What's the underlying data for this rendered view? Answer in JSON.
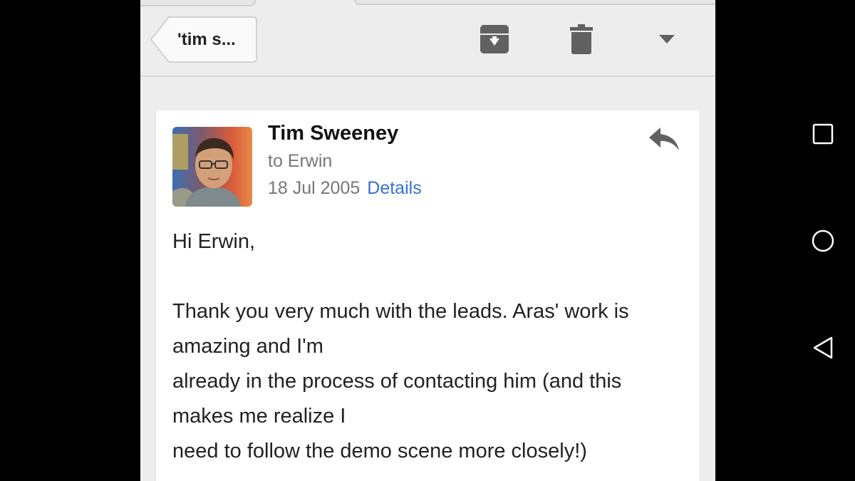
{
  "toolbar": {
    "back_label": "'tim s...",
    "archive_icon": "archive-icon",
    "trash_icon": "trash-icon",
    "more_icon": "dropdown-arrow-icon"
  },
  "email": {
    "sender": "Tim Sweeney",
    "recipient": "to Erwin",
    "date": "18 Jul 2005",
    "details_link": "Details",
    "body": [
      "Hi Erwin,",
      "",
      "Thank you very much with the leads.  Aras' work is",
      "amazing and I'm",
      "already in the process of contacting him (and this",
      "makes me realize I",
      "need to follow the demo scene more closely!)"
    ]
  },
  "colors": {
    "link": "#3a6fd0",
    "icon": "#616161",
    "background": "#ededed"
  },
  "android_nav": {
    "recents_icon": "square-recents-icon",
    "home_icon": "circle-home-icon",
    "back_icon": "triangle-back-icon"
  }
}
